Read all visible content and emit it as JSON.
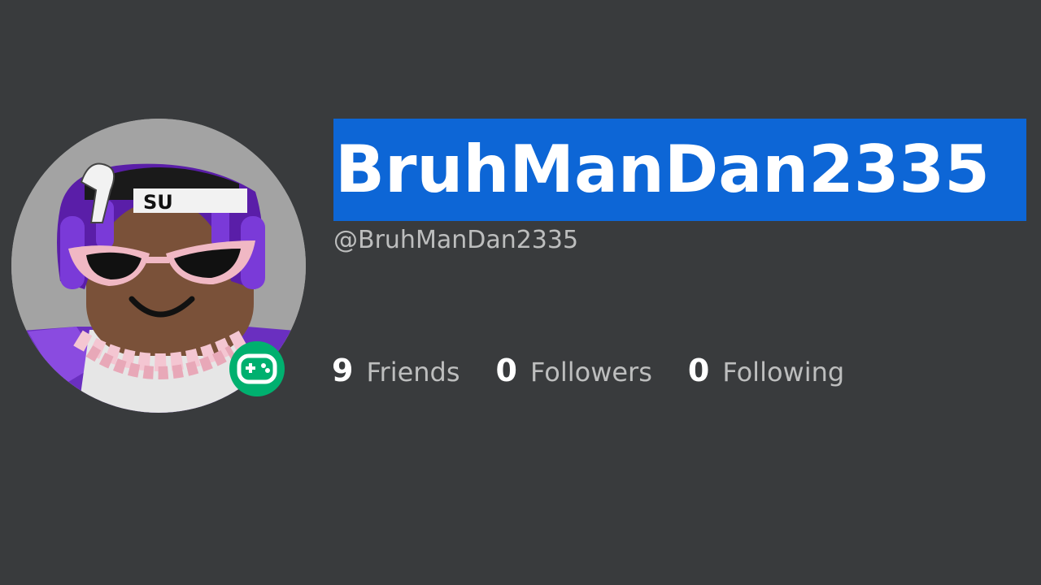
{
  "profile": {
    "display_name": "BruhManDan2335",
    "username": "@BruhManDan2335",
    "presence_icon": "gamepad-icon",
    "colors": {
      "background": "#393b3d",
      "name_highlight": "#0d66d6",
      "presence": "#00b06f"
    }
  },
  "stats": [
    {
      "count": "9",
      "label": "Friends"
    },
    {
      "count": "0",
      "label": "Followers"
    },
    {
      "count": "0",
      "label": "Following"
    }
  ],
  "avatar": {
    "headband_text": "SU"
  }
}
